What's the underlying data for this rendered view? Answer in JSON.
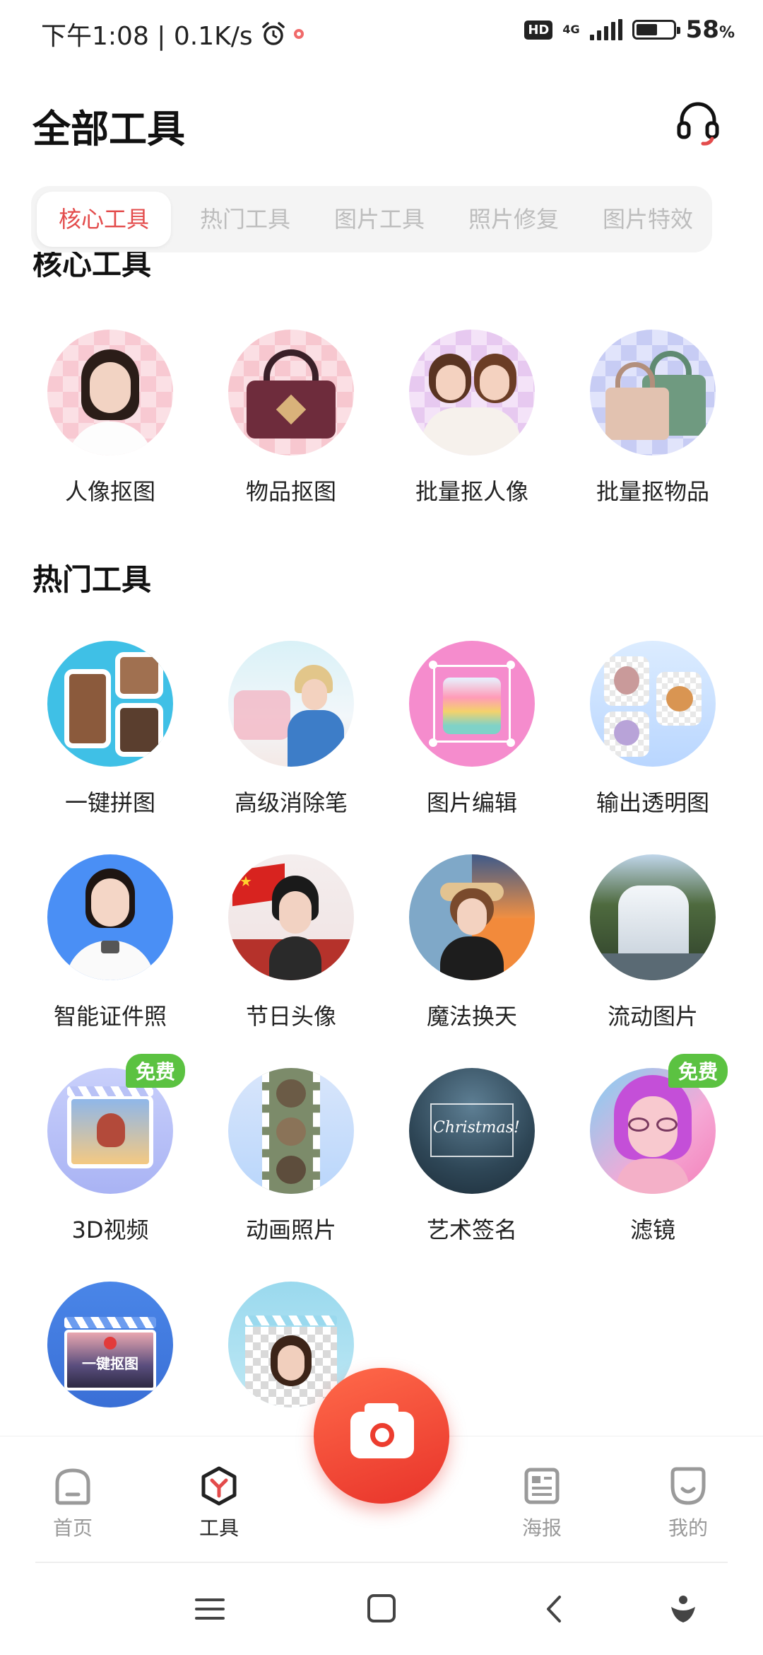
{
  "status_bar": {
    "time_speed": "下午1:08 | 0.1K/s",
    "hd": "HD",
    "network": "4G",
    "battery": "58",
    "battery_unit": "%",
    "battery_level": 0.58
  },
  "header": {
    "title": "全部工具"
  },
  "tabs": [
    {
      "label": "核心工具",
      "active": true
    },
    {
      "label": "热门工具",
      "active": false
    },
    {
      "label": "图片工具",
      "active": false
    },
    {
      "label": "照片修复",
      "active": false
    },
    {
      "label": "图片特效",
      "active": false
    }
  ],
  "sections": {
    "core": {
      "title": "核心工具",
      "items": [
        {
          "label": "人像抠图",
          "icon": "portrait-cutout-icon"
        },
        {
          "label": "物品抠图",
          "icon": "handbag-cutout-icon"
        },
        {
          "label": "批量抠人像",
          "icon": "batch-portrait-icon"
        },
        {
          "label": "批量抠物品",
          "icon": "batch-object-icon"
        }
      ]
    },
    "hot": {
      "title": "热门工具",
      "items": [
        {
          "label": "一键拼图",
          "icon": "collage-icon"
        },
        {
          "label": "高级消除笔",
          "icon": "eraser-pen-icon"
        },
        {
          "label": "图片编辑",
          "icon": "image-edit-icon"
        },
        {
          "label": "输出透明图",
          "icon": "transparent-export-icon"
        },
        {
          "label": "智能证件照",
          "icon": "id-photo-icon"
        },
        {
          "label": "节日头像",
          "icon": "festival-avatar-icon"
        },
        {
          "label": "魔法换天",
          "icon": "sky-replace-icon"
        },
        {
          "label": "流动图片",
          "icon": "waterfall-motion-icon"
        },
        {
          "label": "3D视频",
          "icon": "video-3d-icon",
          "badge": "免费"
        },
        {
          "label": "动画照片",
          "icon": "film-animation-icon"
        },
        {
          "label": "艺术签名",
          "icon": "art-signature-icon",
          "signature_text": "Christmas!"
        },
        {
          "label": "滤镜",
          "icon": "filter-icon",
          "badge": "免费"
        },
        {
          "label": "",
          "icon": "one-click-cutout-icon",
          "image_text": "一键抠图"
        },
        {
          "label": "",
          "icon": "transparent-portrait-icon"
        }
      ]
    }
  },
  "bottom_nav": [
    {
      "label": "首页",
      "icon": "home-icon",
      "active": false
    },
    {
      "label": "工具",
      "icon": "tools-icon",
      "active": true
    },
    {
      "label": "海报",
      "icon": "poster-icon",
      "active": false
    },
    {
      "label": "我的",
      "icon": "profile-icon",
      "active": false
    }
  ],
  "colors": {
    "accent": "#e34b4b",
    "camera": "#ec3d2f",
    "badge": "#5bc241"
  }
}
